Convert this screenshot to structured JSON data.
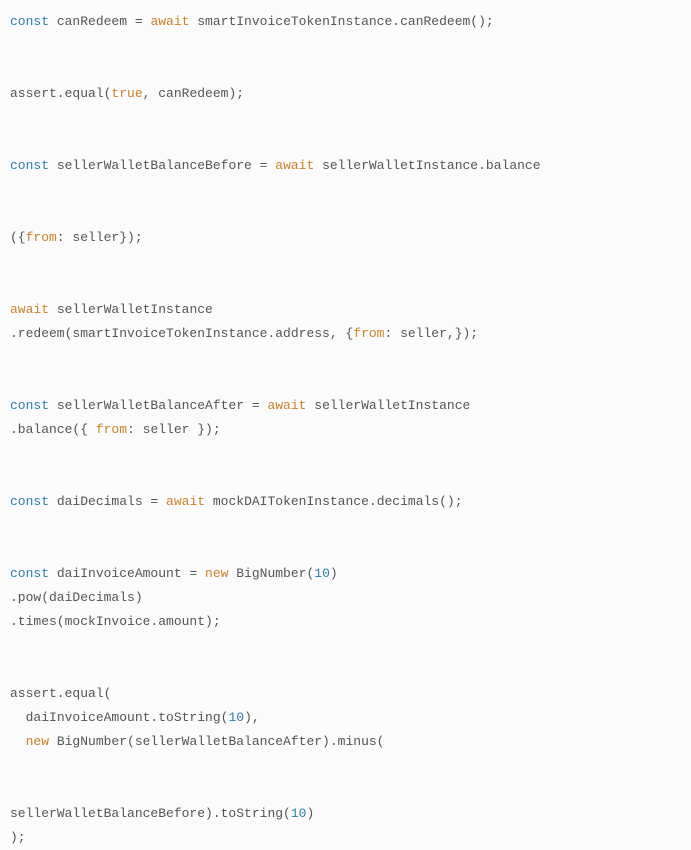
{
  "code": {
    "line1": {
      "const": "const",
      "var": " canRedeem = ",
      "await": "await",
      "rest": " smartInvoiceTokenInstance.canRedeem();"
    },
    "line2": {
      "a": "assert.equal(",
      "true": "true",
      "b": ", canRedeem);"
    },
    "line3": {
      "const": "const",
      "a": " sellerWalletBalanceBefore = ",
      "await": "await",
      "b": " sellerWalletInstance.balance"
    },
    "line4": {
      "a": "({",
      "from": "from",
      "b": ": seller});"
    },
    "line5": {
      "await": "await",
      "a": " sellerWalletInstance"
    },
    "line6": {
      "a": ".redeem(smartInvoiceTokenInstance.address, {",
      "from": "from",
      "b": ": seller,});"
    },
    "line7": {
      "const": "const",
      "a": " sellerWalletBalanceAfter = ",
      "await": "await",
      "b": " sellerWalletInstance"
    },
    "line8": {
      "a": ".balance({ ",
      "from": "from",
      "b": ": seller });"
    },
    "line9": {
      "const": "const",
      "a": " daiDecimals = ",
      "await": "await",
      "b": " mockDAITokenInstance.decimals();"
    },
    "line10": {
      "const": "const",
      "a": " daiInvoiceAmount = ",
      "new": "new",
      "b": " BigNumber(",
      "num": "10",
      "c": ")"
    },
    "line11": {
      "a": ".pow(daiDecimals)"
    },
    "line12": {
      "a": ".times(mockInvoice.amount);"
    },
    "line13": {
      "a": "assert.equal("
    },
    "line14": {
      "a": "  daiInvoiceAmount.toString(",
      "num": "10",
      "b": "),"
    },
    "line15": {
      "a": "  ",
      "new": "new",
      "b": " BigNumber(sellerWalletBalanceAfter).minus("
    },
    "line16": {
      "a": "sellerWalletBalanceBefore).toString(",
      "num": "10",
      "b": ")"
    },
    "line17": {
      "a": ");"
    }
  }
}
